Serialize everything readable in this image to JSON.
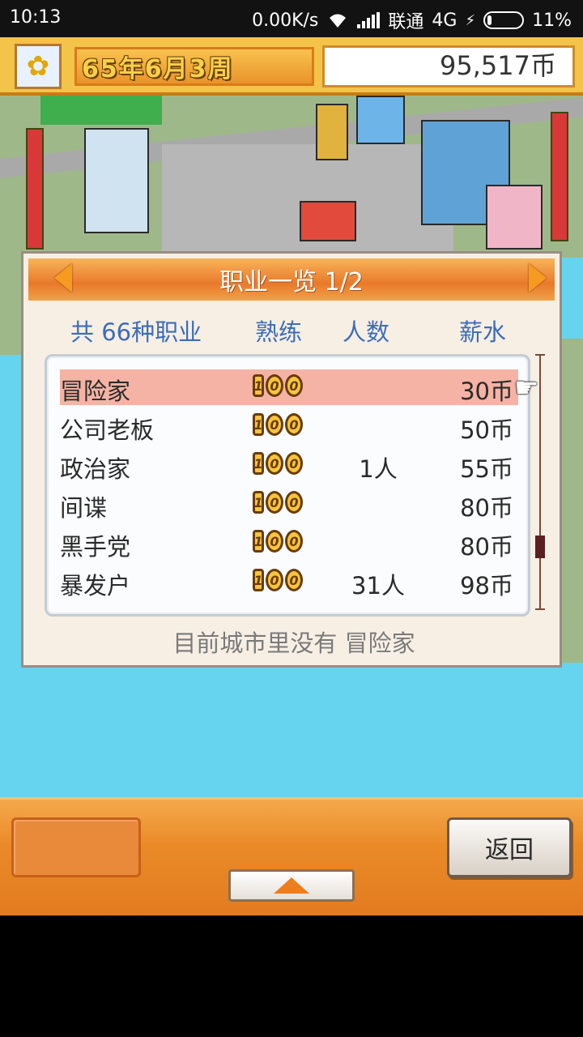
{
  "status_bar": {
    "time": "10:13",
    "network_speed": "0.00K/s",
    "carrier": "联通",
    "network_type": "4G",
    "battery": "11%"
  },
  "top_bar": {
    "date": "65年6月3周",
    "money": "95,517币"
  },
  "dialog": {
    "title": "职业一览 1/2",
    "headers": {
      "total": "共 66种职业",
      "skill": "熟练",
      "people": "人数",
      "salary": "薪水"
    },
    "rows": [
      {
        "job": "冒险家",
        "skill": "100",
        "count": "",
        "salary": "30币",
        "selected": true
      },
      {
        "job": "公司老板",
        "skill": "100",
        "count": "",
        "salary": "50币",
        "selected": false
      },
      {
        "job": "政治家",
        "skill": "100",
        "count": "1人",
        "salary": "55币",
        "selected": false
      },
      {
        "job": "间谍",
        "skill": "100",
        "count": "",
        "salary": "80币",
        "selected": false
      },
      {
        "job": "黑手党",
        "skill": "100",
        "count": "",
        "salary": "80币",
        "selected": false
      },
      {
        "job": "暴发户",
        "skill": "100",
        "count": "31人",
        "salary": "98币",
        "selected": false
      }
    ],
    "footnote": "目前城市里没有 冒险家"
  },
  "bottom_bar": {
    "back_label": "返回"
  },
  "colors": {
    "header_orange": "#e9792b",
    "column_header_blue": "#3c6db9",
    "selected_row": "#f4b3a4",
    "sea": "#66d3ef"
  }
}
